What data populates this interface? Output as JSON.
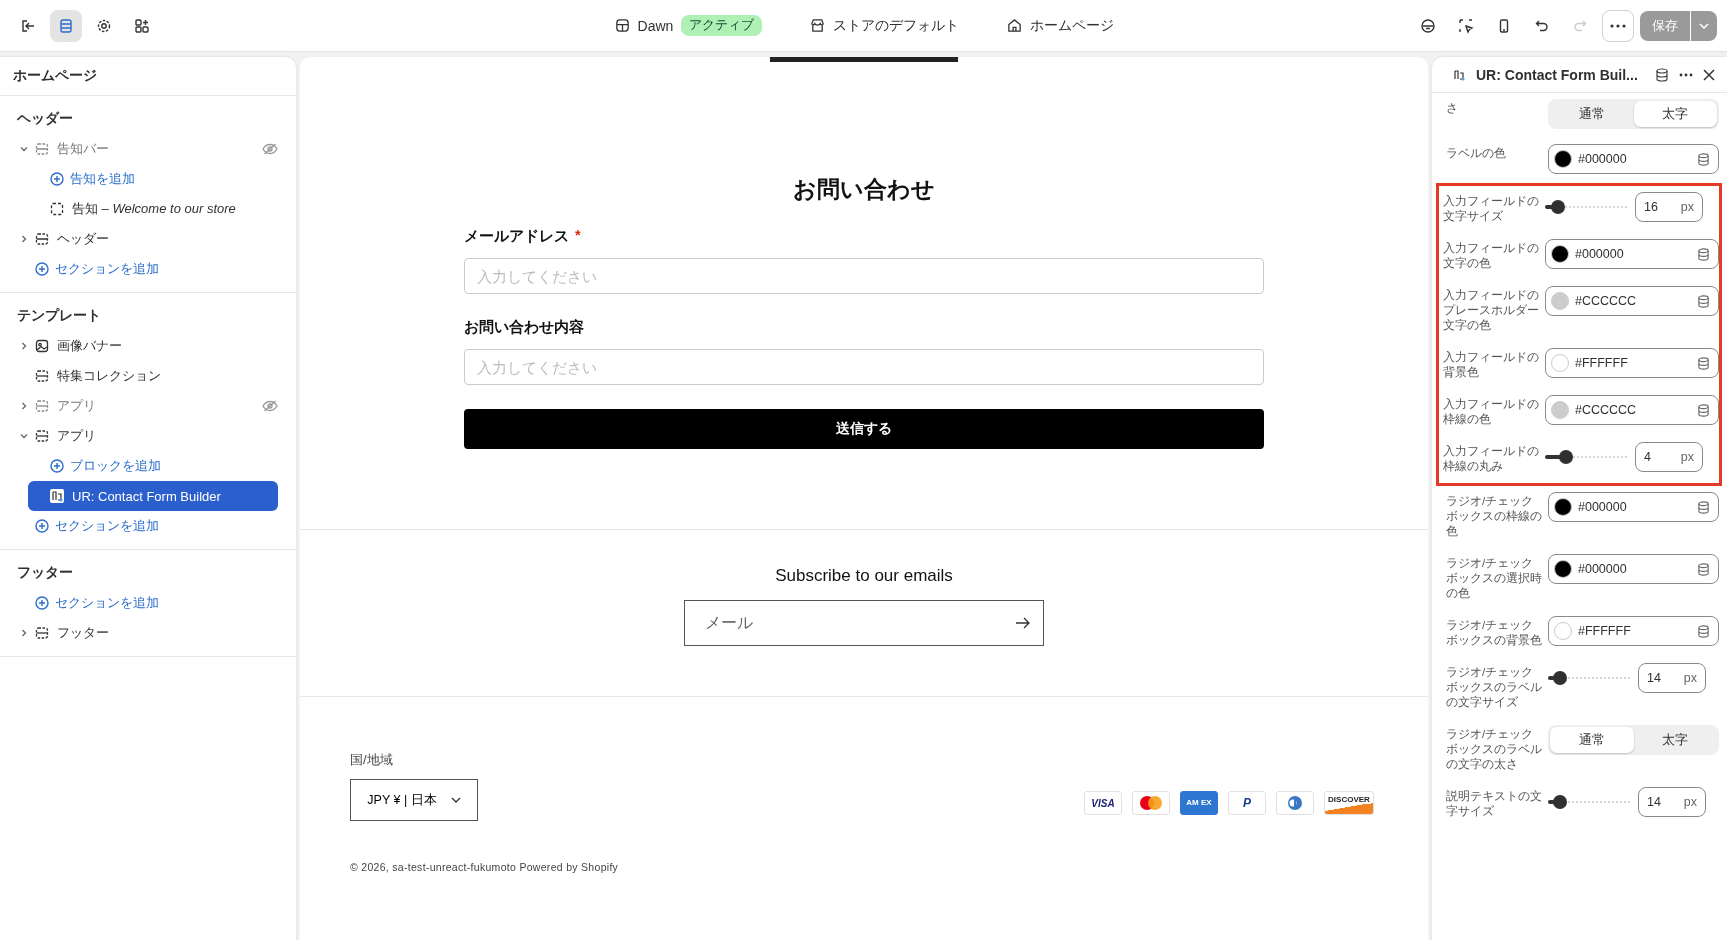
{
  "topbar": {
    "theme": "Dawn",
    "theme_badge": "アクティブ",
    "store": "ストアのデフォルト",
    "page": "ホームページ",
    "save": "保存",
    "save_disabled": true,
    "redo_disabled": true,
    "tools": [
      {
        "kind": "sections",
        "selected": true
      },
      {
        "kind": "settings",
        "selected": false
      },
      {
        "kind": "apps",
        "selected": false
      }
    ]
  },
  "sidebar": {
    "title": "ホームページ",
    "groups": [
      {
        "title": "ヘッダー",
        "items": [
          {
            "kind": "section",
            "label": "告知バー",
            "expanded": true,
            "hidden": true,
            "selected": false,
            "children": [
              {
                "kind": "add",
                "label": "告知を追加"
              },
              {
                "kind": "block",
                "label": "告知 – *Welcome to our store*",
                "selected": false
              }
            ]
          },
          {
            "kind": "section",
            "label": "ヘッダー",
            "expanded": false,
            "hidden": false,
            "selected": false
          },
          {
            "kind": "add",
            "label": "セクションを追加"
          }
        ]
      },
      {
        "title": "テンプレート",
        "items": [
          {
            "kind": "image-section",
            "label": "画像バナー",
            "expanded": false,
            "hidden": false,
            "selected": false
          },
          {
            "kind": "plain-section",
            "label": "特集コレクション",
            "hidden": false,
            "selected": false
          },
          {
            "kind": "section",
            "label": "アプリ",
            "expanded": false,
            "hidden": true,
            "selected": false
          },
          {
            "kind": "section",
            "label": "アプリ",
            "expanded": true,
            "hidden": false,
            "selected": false,
            "children": [
              {
                "kind": "add",
                "label": "ブロックを追加"
              },
              {
                "kind": "app-block",
                "label": "UR: Contact Form Builder",
                "selected": true
              }
            ]
          },
          {
            "kind": "add",
            "label": "セクションを追加"
          }
        ]
      },
      {
        "title": "フッター",
        "items": [
          {
            "kind": "add",
            "label": "セクションを追加"
          },
          {
            "kind": "section",
            "label": "フッター",
            "expanded": false,
            "hidden": false,
            "selected": false
          }
        ]
      }
    ]
  },
  "preview": {
    "form_title": "お問い合わせ",
    "fields": [
      {
        "label": "メールアドレス",
        "required": "*",
        "placeholder": "入力してください"
      },
      {
        "label": "お問い合わせ内容",
        "placeholder": "入力してください"
      }
    ],
    "submit": "送信する",
    "newsletter_title": "Subscribe to our emails",
    "newsletter_placeholder": "メール",
    "country_label": "国/地域",
    "country_value": "JPY ¥ | 日本",
    "payments": [
      {
        "kind": "visa",
        "label": "VISA"
      },
      {
        "kind": "master"
      },
      {
        "kind": "amex",
        "label": "AM EX"
      },
      {
        "kind": "paypal",
        "label": "P"
      },
      {
        "kind": "diners"
      },
      {
        "kind": "discover",
        "label": "DISCOVER"
      }
    ],
    "copyright": "© 2026, sa-test-unreact-fukumoto Powered by Shopify"
  },
  "panel": {
    "title": "UR: Contact Form Buil...",
    "settings": [
      {
        "kind": "segment",
        "label": "さ",
        "options": [
          {
            "label": "通常",
            "selected": false
          },
          {
            "label": "太字",
            "selected": true
          }
        ]
      },
      {
        "kind": "color",
        "label": "ラベルの色",
        "value": "#000000",
        "color": "#000000"
      },
      {
        "kind": "slider",
        "label": "入力フィールドの文字サイズ",
        "value": "16",
        "unit": "px",
        "level": 0.1,
        "highlighted": true
      },
      {
        "kind": "color",
        "label": "入力フィールドの文字の色",
        "value": "#000000",
        "color": "#000000",
        "highlighted": true
      },
      {
        "kind": "color",
        "label": "入力フィールドのプレースホルダー文字の色",
        "value": "#CCCCCC",
        "color": "#cccccc",
        "highlighted": true
      },
      {
        "kind": "color",
        "label": "入力フィールドの背景色",
        "value": "#FFFFFF",
        "color": "#ffffff",
        "highlighted": true
      },
      {
        "kind": "color",
        "label": "入力フィールドの枠線の色",
        "value": "#CCCCCC",
        "color": "#cccccc",
        "highlighted": true
      },
      {
        "kind": "slider",
        "label": "入力フィールドの枠線の丸み",
        "value": "4",
        "unit": "px",
        "level": 0.2,
        "highlighted": true
      },
      {
        "kind": "color",
        "label": "ラジオ/チェックボックスの枠線の色",
        "value": "#000000",
        "color": "#000000"
      },
      {
        "kind": "color",
        "label": "ラジオ/チェックボックスの選択時の色",
        "value": "#000000",
        "color": "#000000"
      },
      {
        "kind": "color",
        "label": "ラジオ/チェックボックスの背景色",
        "value": "#FFFFFF",
        "color": "#ffffff"
      },
      {
        "kind": "slider",
        "label": "ラジオ/チェックボックスのラベルの文字サイズ",
        "value": "14",
        "unit": "px",
        "level": 0.08
      },
      {
        "kind": "segment",
        "label": "ラジオ/チェックボックスのラベルの文字の太さ",
        "options": [
          {
            "label": "通常",
            "selected": true
          },
          {
            "label": "太字",
            "selected": false
          }
        ]
      },
      {
        "kind": "slider",
        "label": "説明テキストの文字サイズ",
        "value": "14",
        "unit": "px",
        "level": 0.08
      }
    ]
  }
}
